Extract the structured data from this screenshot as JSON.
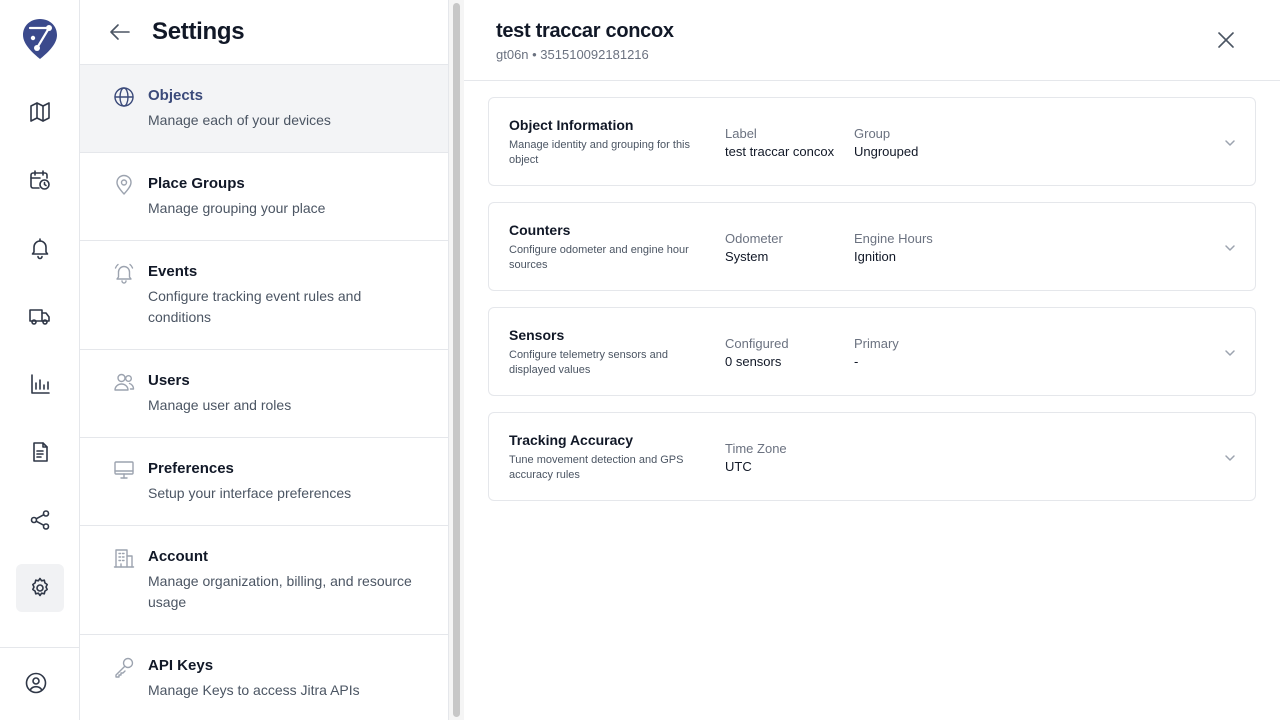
{
  "settings": {
    "title": "Settings",
    "items": [
      {
        "title": "Objects",
        "desc": "Manage each of your devices"
      },
      {
        "title": "Place Groups",
        "desc": "Manage grouping your place"
      },
      {
        "title": "Events",
        "desc": "Configure tracking event rules and conditions"
      },
      {
        "title": "Users",
        "desc": "Manage user and roles"
      },
      {
        "title": "Preferences",
        "desc": "Setup your interface preferences"
      },
      {
        "title": "Account",
        "desc": "Manage organization, billing, and resource usage"
      },
      {
        "title": "API Keys",
        "desc": "Manage Keys to access Jitra APIs"
      }
    ]
  },
  "detail": {
    "title": "test traccar concox",
    "subtitle": "gt06n • 351510092181216",
    "cards": [
      {
        "title": "Object Information",
        "desc": "Manage identity and grouping for this object",
        "fields": [
          {
            "label": "Label",
            "value": "test traccar concox"
          },
          {
            "label": "Group",
            "value": "Ungrouped"
          }
        ]
      },
      {
        "title": "Counters",
        "desc": "Configure odometer and engine hour sources",
        "fields": [
          {
            "label": "Odometer",
            "value": "System"
          },
          {
            "label": "Engine Hours",
            "value": "Ignition"
          }
        ]
      },
      {
        "title": "Sensors",
        "desc": "Configure telemetry sensors and displayed values",
        "fields": [
          {
            "label": "Configured",
            "value": "0 sensors"
          },
          {
            "label": "Primary",
            "value": "-"
          }
        ]
      },
      {
        "title": "Tracking Accuracy",
        "desc": "Tune movement detection and GPS accuracy rules",
        "fields": [
          {
            "label": "Time Zone",
            "value": "UTC"
          }
        ]
      }
    ]
  },
  "icons": {
    "rail": [
      "logo-icon",
      "map-icon",
      "calendar-clock-icon",
      "bell-icon",
      "truck-icon",
      "bar-chart-icon",
      "document-icon",
      "share-icon",
      "gear-icon",
      "user-circle-icon"
    ],
    "menu": [
      "globe-icon",
      "map-pin-icon",
      "bell-ring-icon",
      "users-icon",
      "monitor-icon",
      "building-icon",
      "key-icon"
    ]
  },
  "colors": {
    "accent": "#3b4a7a",
    "logo": "#3b4a8c"
  }
}
